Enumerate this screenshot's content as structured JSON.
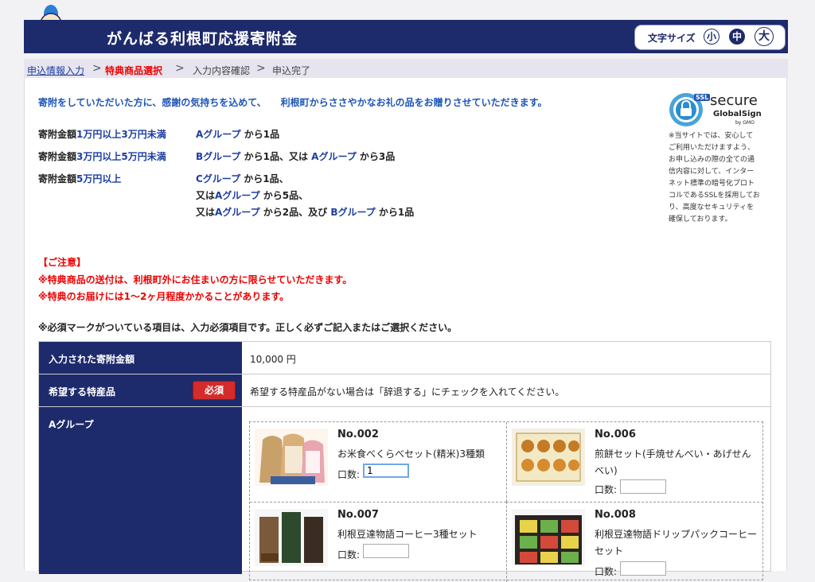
{
  "header": {
    "title": "がんばる利根町応援寄附金",
    "font_size_label": "文字サイズ",
    "font_sizes": [
      "小",
      "中",
      "大"
    ],
    "active_font_size": "中"
  },
  "breadcrumb": {
    "step1": "申込情報入力",
    "step2": "特典商品選択",
    "step3": "入力内容確認",
    "step4": "申込完了",
    "sep": ">"
  },
  "intro": "寄附をしていただいた方に、感謝の気持ちを込めて、　　利根町からささやかなお礼の品をお贈りさせていただきます。",
  "conditions": {
    "c1_label_a": "寄附金額",
    "c1_label_b": "1万円以上3万円未満",
    "c1_g1": "Aグループ",
    "c1_t1": " から1品",
    "c2_label_a": "寄附金額",
    "c2_label_b": "3万円以上5万円未満",
    "c2_g1": "Bグループ",
    "c2_t1": " から1品、又は ",
    "c2_g2": "Aグループ",
    "c2_t2": " から3品",
    "c3_label_a": "寄附金額",
    "c3_label_b": "5万円以上",
    "c3_l1_g": "Cグループ",
    "c3_l1_t": " から1品、",
    "c3_l2_pre": "又は",
    "c3_l2_g": "Aグループ",
    "c3_l2_t": " から5品、",
    "c3_l3_pre": "又は",
    "c3_l3_g": "Aグループ",
    "c3_l3_t": " から2品、及び ",
    "c3_l3_g2": "Bグループ",
    "c3_l3_t2": " から1品"
  },
  "notices": {
    "title": "【ご注意】",
    "line1": "※特典商品の送付は、利根町外にお住まいの方に限らせていただきます。",
    "line2": "※特典のお届けには1～2ヶ月程度かかることがあります。"
  },
  "required_note": "※必須マークがついている項目は、入力必須項目です。正しく必ずご記入またはご選択ください。",
  "ssl": {
    "badge": "SSL",
    "secure": "secure",
    "brand": "GlobalSign",
    "by": "by GMO",
    "text": "※当サイトでは、安心してご利用いただけますよう、お申し込みの際の全ての通信内容に対して、インターネット標準の暗号化プロトコルであるSSLを採用しており、高度なセキュリティを確保しております。"
  },
  "form": {
    "amount_label": "入力された寄附金額",
    "amount_value": "10,000 円",
    "wish_label": "希望する特産品",
    "required_badge": "必須",
    "wish_note": "希望する特産品がない場合は「辞退する」にチェックを入れてください。",
    "group_label": "Aグループ",
    "qty_label": "口数:",
    "products": [
      {
        "no": "No.002",
        "name": "お米食べくらべセット(精米)3種類",
        "qty": "1"
      },
      {
        "no": "No.006",
        "name": "煎餅セット(手焼せんべい・あげせんべい)",
        "qty": ""
      },
      {
        "no": "No.007",
        "name": "利根豆達物語コーヒー3種セット",
        "qty": ""
      },
      {
        "no": "No.008",
        "name": "利根豆達物語ドリップパックコーヒーセット",
        "qty": ""
      }
    ]
  },
  "colors": {
    "navy": "#1d2a6b",
    "link": "#1d3ea0",
    "alert": "#e00000"
  }
}
